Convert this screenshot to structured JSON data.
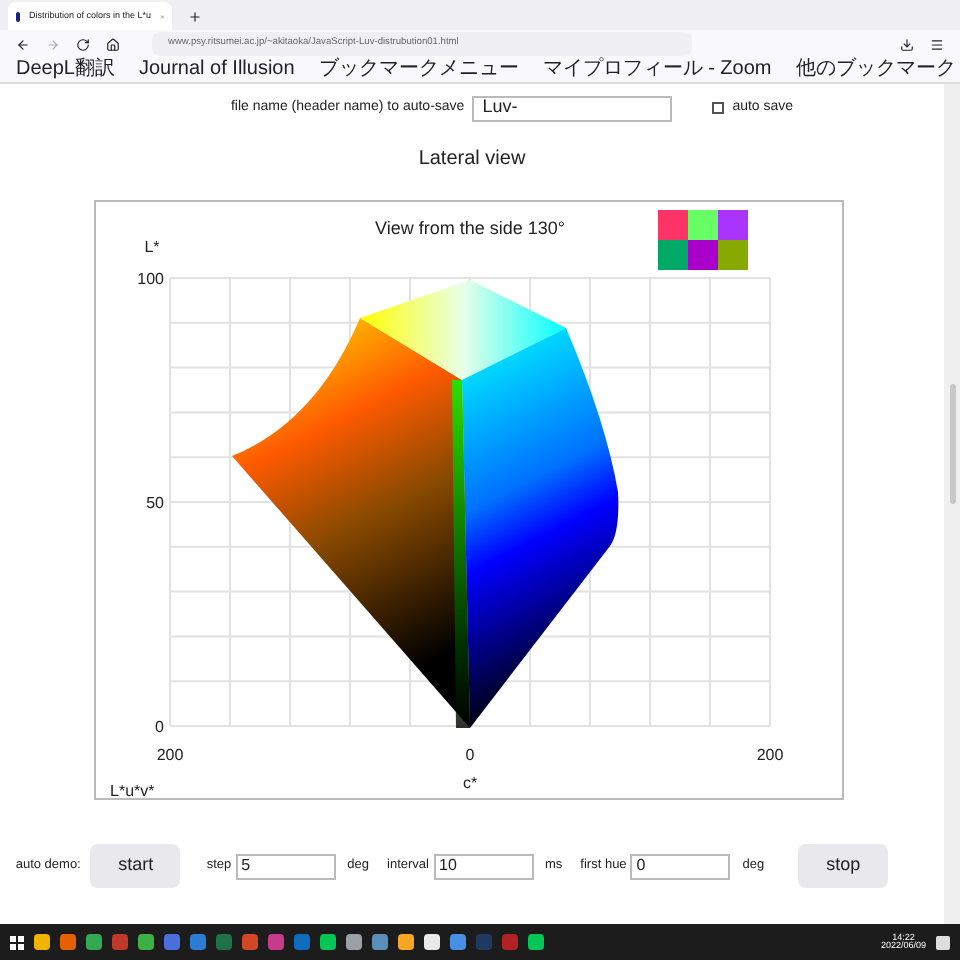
{
  "browser": {
    "tab": {
      "title": "Distribution of colors in the L*u"
    },
    "address": "www.psy.ritsumei.ac.jp/~akitaoka/JavaScript-Luv-distrubution01.html",
    "bookmarks": [
      "DeepL翻訳",
      "Journal of Illusion",
      "ブックマークメニュー",
      "マイプロフィール - Zoom"
    ],
    "other_bookmarks": "他のブックマーク"
  },
  "autosave": {
    "label": "file name (header name) to auto-save",
    "value": "Luv-",
    "checkbox": {
      "label": "auto save",
      "checked": false
    }
  },
  "heading": "Lateral view",
  "chart": {
    "title": "View from the side 130°",
    "y_axis_label": "L*",
    "y_ticks": [
      "100",
      "50",
      "0"
    ],
    "x_ticks": [
      "200",
      "0",
      "200"
    ],
    "x_axis_label": "c*",
    "space_label": "L*u*v*"
  },
  "controls": {
    "auto_demo_label": "auto demo:",
    "start": "start",
    "fields": [
      {
        "label": "step",
        "value": "5",
        "unit": "deg"
      },
      {
        "label": "interval",
        "value": "10",
        "unit": "ms"
      },
      {
        "label": "first hue",
        "value": "0",
        "unit": "deg"
      }
    ],
    "stop": "stop"
  },
  "taskbar": {
    "time": "14:22",
    "date": "2022/06/09"
  }
}
